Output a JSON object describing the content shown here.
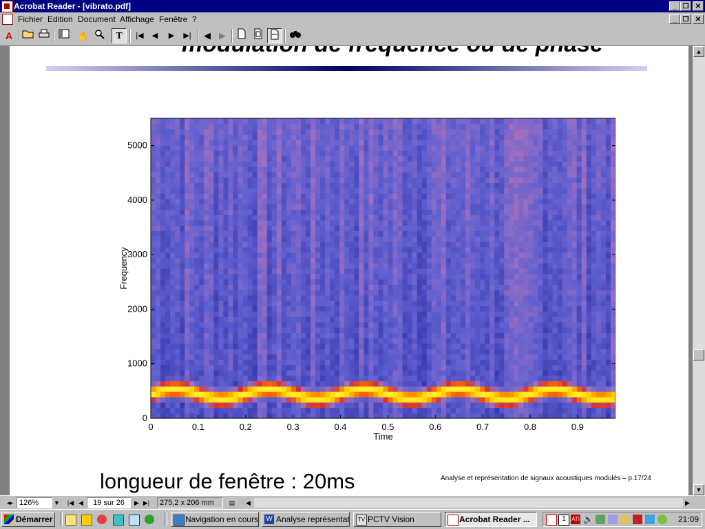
{
  "window": {
    "title": "Acrobat Reader - [vibrato.pdf]",
    "controls": [
      "_",
      "❐",
      "✕"
    ]
  },
  "menubar": {
    "items": [
      "Fichier",
      "Edition",
      "Document",
      "Affichage",
      "Fenêtre",
      "?"
    ],
    "doc_controls": [
      "_",
      "❐",
      "✕"
    ]
  },
  "toolbar": {
    "icons": [
      "acrobat-icon",
      "open-icon",
      "print-icon",
      "thumbnails-icon",
      "hand-icon",
      "zoom-icon",
      "text-select-icon",
      "first-page-icon",
      "prev-page-icon",
      "next-page-icon",
      "last-page-icon",
      "go-back-icon",
      "go-forward-icon",
      "actual-size-icon",
      "fit-page-icon",
      "fit-width-icon",
      "find-icon"
    ]
  },
  "slide": {
    "title_partial": "modulation de fréquence ou de phase",
    "bottom_text": "longueur de fenêtre : 20ms",
    "footer": "Analyse et représentation de signaux acoustiques modulés – p.17/24"
  },
  "chart_data": {
    "type": "heatmap",
    "description_kind": "spectrogram",
    "xlabel": "Time",
    "ylabel": "Frequency",
    "xlim": [
      0,
      0.98
    ],
    "ylim": [
      0,
      5500
    ],
    "xticks": [
      "0",
      "0.1",
      "0.2",
      "0.3",
      "0.4",
      "0.5",
      "0.6",
      "0.7",
      "0.8",
      "0.9"
    ],
    "yticks": [
      "0",
      "1000",
      "2000",
      "3000",
      "4000",
      "5000"
    ],
    "ridge": {
      "center_hz": 450,
      "depth_hz": 90,
      "period_s": 0.2
    },
    "colormap": [
      "#2a2a8a",
      "#3a3ab0",
      "#6060d0",
      "#a070c0",
      "#d03040",
      "#ff7000",
      "#ffd000",
      "#ffff40"
    ]
  },
  "statusbar": {
    "zoom": "126%",
    "page": "19 sur 26",
    "size": "275,2 x 206 mm"
  },
  "taskbar": {
    "start": "Démarrer",
    "tasks": [
      {
        "label": "Navigation en cours...",
        "active": false
      },
      {
        "label": "Analyse représentati...",
        "active": false
      },
      {
        "label": "PCTV Vision",
        "active": false
      },
      {
        "label": "Acrobat Reader ...",
        "active": true
      }
    ],
    "clock": "21:09"
  },
  "colors": {
    "titlebar": "#000080",
    "desktop_gray": "#c0c0c0",
    "rule_dark": "#000060"
  }
}
